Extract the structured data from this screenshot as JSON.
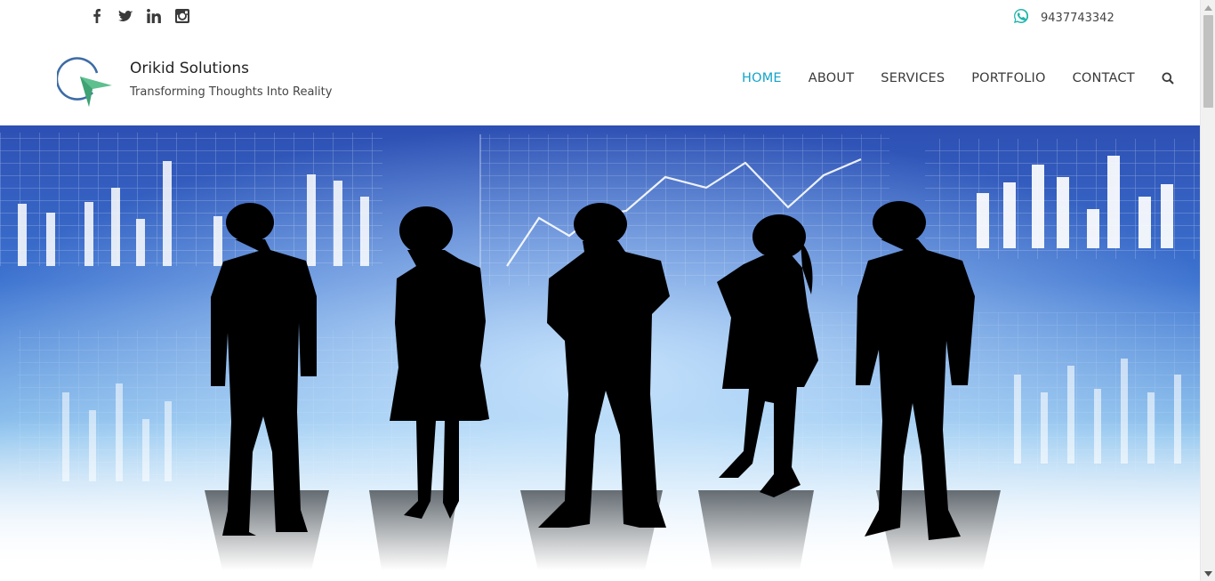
{
  "topbar": {
    "social": [
      {
        "icon": "facebook-icon"
      },
      {
        "icon": "twitter-icon"
      },
      {
        "icon": "linkedin-icon"
      },
      {
        "icon": "instagram-icon"
      }
    ],
    "phone_icon": "whatsapp-icon",
    "phone": "9437743342"
  },
  "brand": {
    "name": "Orikid Solutions",
    "tagline": "Transforming Thoughts Into Reality"
  },
  "nav": {
    "items": [
      "HOME",
      "ABOUT",
      "SERVICES",
      "PORTFOLIO",
      "CONTACT"
    ],
    "active": "HOME",
    "search_icon": "search-icon"
  },
  "colors": {
    "accent": "#13a4c9",
    "whatsapp": "#1fb5a8",
    "logo_ring": "#3d6ca6",
    "logo_arrow": "#5ec08f",
    "hero_blue": "#2a55b8"
  }
}
